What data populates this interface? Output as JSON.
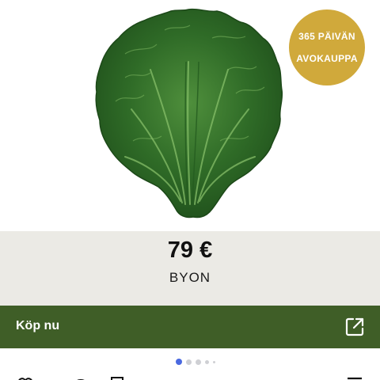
{
  "product": {
    "image_alt": "Green cabbage leaf ceramic plate",
    "price": "79 €",
    "brand": "BYON"
  },
  "badge": {
    "line1": "365 PÄIVÄN",
    "line2": "AVOKAUPPA"
  },
  "buy": {
    "label": "Köp nu",
    "icon": "external-link-icon"
  },
  "pagination": {
    "total_dots": 5,
    "active_index": 0
  },
  "toolbar": {
    "icons": [
      "heart-icon",
      "comment-icon",
      "bookmark-icon",
      "menu-icon"
    ]
  },
  "colors": {
    "badge": "#d0a93b",
    "price_band": "#ebeae5",
    "buy_bar": "#3f5e27",
    "dot_active": "#4a69e0",
    "dot_inactive": "#cfd0d4"
  }
}
